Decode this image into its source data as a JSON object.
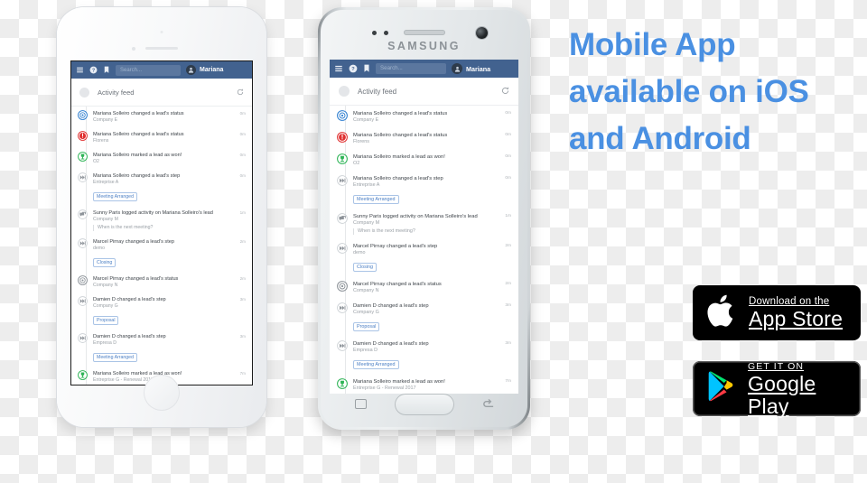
{
  "headline": "Mobile App available on iOS and Android",
  "colors": {
    "headline_blue": "#4a90e2",
    "app_header_blue": "#42628f",
    "tag_blue": "#4b7fc4",
    "status_blue": "#2f7fd0",
    "status_red": "#e03030",
    "status_green": "#2fb457",
    "badge_black": "#000000"
  },
  "phones": {
    "iphone": {
      "label": "iPhone",
      "home_button": "home-button"
    },
    "samsung": {
      "label": "Samsung",
      "brand": "SAMSUNG",
      "nav": {
        "recents": "recents-button",
        "home": "home-button",
        "back": "back-button"
      }
    }
  },
  "app": {
    "header": {
      "menu_icon": "hamburger-menu-icon",
      "help_icon": "help-circle-icon",
      "bookmark_icon": "bookmark-icon",
      "search_placeholder": "Search...",
      "user_name": "Mariana",
      "avatar_icon": "user-avatar-icon"
    },
    "feed": {
      "title": "Activity feed",
      "refresh_icon": "refresh-icon",
      "items": [
        {
          "icon": "target-icon",
          "icon_color": "#2f7fd0",
          "title": "Mariana Solleiro changed a lead's status",
          "subtitle": "Company E",
          "time": "0m",
          "tag": "",
          "quote": ""
        },
        {
          "icon": "alert-icon",
          "icon_color": "#e03030",
          "title": "Mariana Solleiro changed a lead's status",
          "subtitle": "Florens",
          "time": "0m",
          "tag": "",
          "quote": ""
        },
        {
          "icon": "trophy-icon",
          "icon_color": "#2fb457",
          "title": "Mariana Solleiro marked a lead as won!",
          "subtitle": "O2",
          "time": "0m",
          "tag": "",
          "quote": ""
        },
        {
          "icon": "next-step-icon",
          "icon_color": "#8d9399",
          "title": "Mariana Solleiro changed a lead's step",
          "subtitle": "Entreprise A",
          "time": "0m",
          "tag": "Meeting Arranged",
          "quote": ""
        },
        {
          "icon": "comment-icon",
          "icon_color": "#8d9399",
          "title": "Sunny Paris logged activity on Mariana Solleiro's lead",
          "subtitle": "Company M",
          "time": "1m",
          "tag": "",
          "quote": "When is the next meeting?"
        },
        {
          "icon": "next-step-icon",
          "icon_color": "#8d9399",
          "title": "Marcel Pirnay changed a lead's step",
          "subtitle": "demo",
          "time": "2m",
          "tag": "Closing",
          "quote": ""
        },
        {
          "icon": "target-icon",
          "icon_color": "#8d9399",
          "title": "Marcel Pirnay changed a lead's status",
          "subtitle": "Company N",
          "time": "2m",
          "tag": "",
          "quote": ""
        },
        {
          "icon": "next-step-icon",
          "icon_color": "#8d9399",
          "title": "Damien D changed a lead's step",
          "subtitle": "Company G",
          "time": "3m",
          "tag": "Proposal",
          "quote": ""
        },
        {
          "icon": "next-step-icon",
          "icon_color": "#8d9399",
          "title": "Damien D changed a lead's step",
          "subtitle": "Empresa D",
          "time": "3m",
          "tag": "Meeting Arranged",
          "quote": ""
        },
        {
          "icon": "trophy-icon",
          "icon_color": "#2fb457",
          "title": "Mariana Solleiro marked a lead as won!",
          "subtitle": "Entreprise G - Renewal 2017",
          "time": "7m",
          "tag": "",
          "quote": ""
        }
      ]
    }
  },
  "badges": {
    "appstore": {
      "line1": "Download on the",
      "line2": "App Store",
      "icon": "apple-logo-icon"
    },
    "googleplay": {
      "line1": "GET IT ON",
      "line2": "Google Play",
      "icon": "google-play-logo-icon"
    }
  }
}
